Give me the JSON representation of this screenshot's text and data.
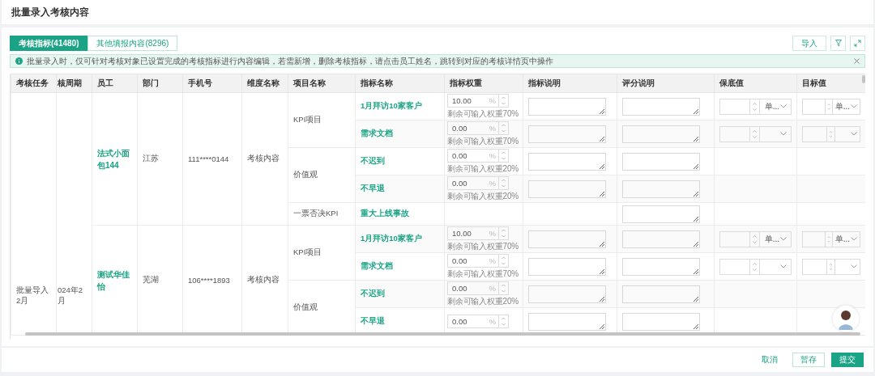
{
  "page": {
    "title": "批量录入考核内容"
  },
  "tabs": [
    {
      "label": "考核指标(41480)",
      "selected": true
    },
    {
      "label": "其他填报内容(8296)",
      "selected": false
    }
  ],
  "toolbar": {
    "import_button": "导入"
  },
  "alert": {
    "text": "批量录入时，仅可针对考核对象已设置完成的考核指标进行内容编辑，若需新增，删除考核指标，请点击员工姓名，跳转到对应的考核详情页中操作"
  },
  "table": {
    "columns": [
      "考核任务",
      "核周期",
      "员工",
      "部门",
      "手机号",
      "维度名称",
      "项目名称",
      "指标名称",
      "指标权重",
      "指标说明",
      "评分说明",
      "保底值",
      "目标值"
    ],
    "groups": [
      {
        "task": "批量导入2月",
        "period": "024年2月",
        "employees": [
          {
            "name": "法式小面包144",
            "department": "江苏",
            "phone": "111****0144",
            "dimension": "考核内容",
            "projects": [
              {
                "name": "KPI项目",
                "indicators": [
                  {
                    "name": "1月拜访10家客户",
                    "weight": {
                      "value": "10.00",
                      "unit": "%",
                      "hint": "剩余可输入权重70%"
                    },
                    "description_field": true,
                    "scoring_field": true,
                    "floor": {
                      "kind": "unit",
                      "unit": "单..."
                    },
                    "target": {
                      "kind": "unit",
                      "unit": "单..."
                    }
                  },
                  {
                    "name": "需求文档",
                    "weight": {
                      "value": "0.00",
                      "unit": "%",
                      "hint": "剩余可输入权重70%"
                    },
                    "description_field": true,
                    "scoring_field": true,
                    "floor": {
                      "kind": "empty"
                    },
                    "target": {
                      "kind": "empty"
                    }
                  }
                ]
              },
              {
                "name": "价值观",
                "indicators": [
                  {
                    "name": "不迟到",
                    "weight": {
                      "value": "0.00",
                      "unit": "%",
                      "hint": "剩余可输入权重20%"
                    },
                    "description_field": true,
                    "scoring_field": true
                  },
                  {
                    "name": "不早退",
                    "weight": {
                      "value": "0.00",
                      "unit": "%",
                      "hint": "剩余可输入权重20%"
                    },
                    "description_field": true,
                    "scoring_field": true
                  }
                ]
              },
              {
                "name": "一票否决KPI",
                "indicators": [
                  {
                    "name": "重大上线事故",
                    "description_field": false,
                    "scoring_field": true
                  }
                ]
              }
            ]
          },
          {
            "name": "测试华佳怡",
            "department": "芜湖",
            "phone": "106****1893",
            "dimension": "考核内容",
            "projects": [
              {
                "name": "KPI项目",
                "indicators": [
                  {
                    "name": "1月拜访10家客户",
                    "weight": {
                      "value": "10.00",
                      "unit": "%",
                      "hint": "剩余可输入权重70%"
                    },
                    "description_field": true,
                    "scoring_field": true,
                    "floor": {
                      "kind": "unit",
                      "unit": "单..."
                    },
                    "target": {
                      "kind": "unit",
                      "unit": "单..."
                    }
                  },
                  {
                    "name": "需求文档",
                    "weight": {
                      "value": "0.00",
                      "unit": "%",
                      "hint": "剩余可输入权重70%"
                    },
                    "description_field": true,
                    "scoring_field": true,
                    "floor": {
                      "kind": "empty"
                    },
                    "target": {
                      "kind": "empty"
                    }
                  }
                ]
              },
              {
                "name": "价值观",
                "indicators": [
                  {
                    "name": "不迟到",
                    "weight": {
                      "value": "0.00",
                      "unit": "%",
                      "hint": "剩余可输入权重20%"
                    },
                    "description_field": true,
                    "scoring_field": true
                  },
                  {
                    "name": "不早退",
                    "weight": {
                      "value": "0.00",
                      "unit": "%"
                    },
                    "description_field": true,
                    "scoring_field": true
                  }
                ]
              }
            ]
          }
        ]
      }
    ]
  },
  "footer": {
    "buttons": [
      {
        "label": "取消",
        "kind": "link"
      },
      {
        "label": "暂存",
        "kind": "outline"
      },
      {
        "label": "提交",
        "kind": "primary"
      }
    ]
  }
}
